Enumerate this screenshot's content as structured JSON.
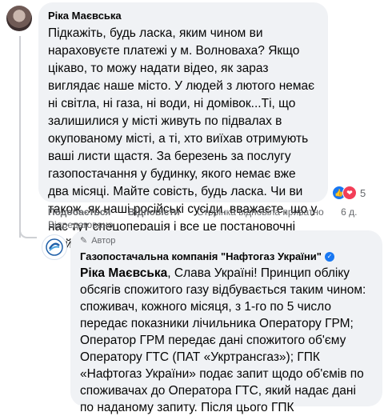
{
  "comment": {
    "author": "Ріка Маєвська",
    "text": "Підкажіть, будь ласка, яким чином ви нараховуєте платежі у м. Волноваха? Якщо цікаво, то можу надати відео, як зараз виглядає наше місто. У людей з лютого немає ні світла, ні газа, ні води, ні домівок...Ті, що залишилися у місті живуть по підвалах в окупованому місті, а ті, хто виїхав отримують ваші листи щастя. За березень за послугу газопостачання у будинку, якого немає вже два місяці. Майте совість, будь ласка. Чи ви також, як наші російські сусіди, вважаєте, що у нас тут спецоперація і все це постановочні фейки?",
    "reaction_count": "5",
    "reaction_icons": [
      "like-icon",
      "heart-icon"
    ],
    "actions": {
      "like": "Подобається",
      "reply": "Відповісти",
      "private_reply": "Сторінка відповіла приватно",
      "time": "6 д.",
      "edited": "Відредаговано"
    }
  },
  "reply": {
    "badge": "Автор",
    "page_name": "Газопостачальна компанія \"Нафтогаз України\"",
    "mention": "Ріка Маєвська",
    "text": ", Слава Україні! Принцип обліку обсягів спожитого газу відбувається таким чином: споживач, кожного місяця, з 1-го по 5 число передає показники лічильника Оператору ГРМ; Оператор ГРМ передає дані спожитого об'єму Оператору ГТС (ПАТ «Укртрансгаз»); ГПК «Нафтогаз України» подає запит щодо об'ємів по споживачах до Оператора ГТС, який надає дані по наданому запиту. Після цього ГПК"
  },
  "colors": {
    "bubble": "#f0f2f5",
    "secondary_text": "#65676b",
    "brand_blue": "#1877f2"
  }
}
